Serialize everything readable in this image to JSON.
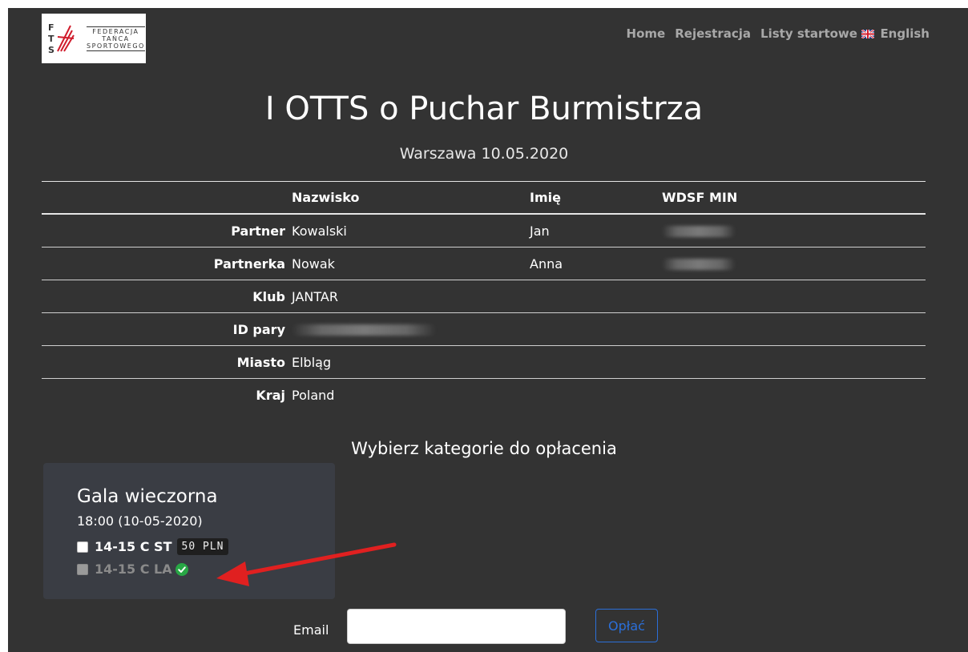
{
  "header": {
    "logo": {
      "mark": "FTS",
      "lines": [
        "FEDERACJA",
        "TAŃCA",
        "SPORTOWEGO"
      ]
    },
    "nav": [
      "Home",
      "Rejestracja",
      "Listy startowe",
      "English"
    ],
    "flag_icon": "uk-flag-icon"
  },
  "event": {
    "title": "I OTTS o Puchar Burmistrza",
    "subtitle": "Warszawa 10.05.2020"
  },
  "table": {
    "columns": [
      "Nazwisko",
      "Imię",
      "WDSF MIN"
    ],
    "rows": [
      {
        "label": "Partner",
        "surname": "Kowalski",
        "name": "Jan"
      },
      {
        "label": "Partnerka",
        "surname": "Nowak",
        "name": "Anna"
      },
      {
        "label": "Klub",
        "value": "JANTAR"
      },
      {
        "label": "ID pary"
      },
      {
        "label": "Miasto",
        "value": "Elbląg"
      },
      {
        "label": "Kraj",
        "value": "Poland"
      }
    ]
  },
  "section_heading": "Wybierz kategorie do opłacenia",
  "card": {
    "title": "Gala wieczorna",
    "time": "18:00 (10-05-2020)",
    "categories": [
      {
        "label": "14-15 C ST",
        "price": "50 PLN",
        "checked": false
      },
      {
        "label": "14-15 C LA",
        "paid": true,
        "status_icon": "check-circle-icon"
      }
    ]
  },
  "form": {
    "email_label": "Email",
    "email_value": "",
    "pay_button": "Opłać"
  },
  "colors": {
    "background": "#333333",
    "card": "#3a3d44",
    "accent": "#2b6fd9",
    "success": "#28a745",
    "annotation_arrow": "#e02020"
  }
}
